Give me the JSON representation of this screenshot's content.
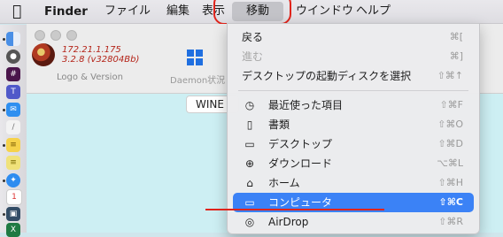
{
  "menubar": {
    "app_name": "Finder",
    "items": [
      "ファイル",
      "編集",
      "表示",
      "移動",
      "ウインドウ",
      "ヘルプ"
    ]
  },
  "window": {
    "ip": "172.21.1.175",
    "version": "3.2.8 (v32804Bb)",
    "logo_caption": "Logo & Version",
    "daemon_caption": "Daemon状況",
    "tab_label": "WINE"
  },
  "go_menu": {
    "items": [
      {
        "label": "戻る",
        "shortcut": "⌘[",
        "enabled": true
      },
      {
        "label": "進む",
        "shortcut": "⌘]",
        "enabled": false
      },
      {
        "label": "デスクトップの起動ディスクを選択",
        "shortcut": "⇧⌘↑",
        "enabled": true
      },
      {
        "label": "最近使った項目",
        "shortcut": "⇧⌘F",
        "icon": "clock-icon"
      },
      {
        "label": "書類",
        "shortcut": "⇧⌘O",
        "icon": "document-icon"
      },
      {
        "label": "デスクトップ",
        "shortcut": "⇧⌘D",
        "icon": "desktop-icon"
      },
      {
        "label": "ダウンロード",
        "shortcut": "⌥⌘L",
        "icon": "download-icon"
      },
      {
        "label": "ホーム",
        "shortcut": "⇧⌘H",
        "icon": "home-icon"
      },
      {
        "label": "コンピュータ",
        "shortcut": "⇧⌘C",
        "icon": "computer-icon",
        "selected": true
      },
      {
        "label": "AirDrop",
        "shortcut": "⇧⌘R",
        "icon": "airdrop-icon"
      }
    ]
  },
  "colors": {
    "highlight_red": "#e0241b",
    "menu_selection": "#3b82f6",
    "window_content": "#cdeff3",
    "version_text": "#b42318"
  }
}
